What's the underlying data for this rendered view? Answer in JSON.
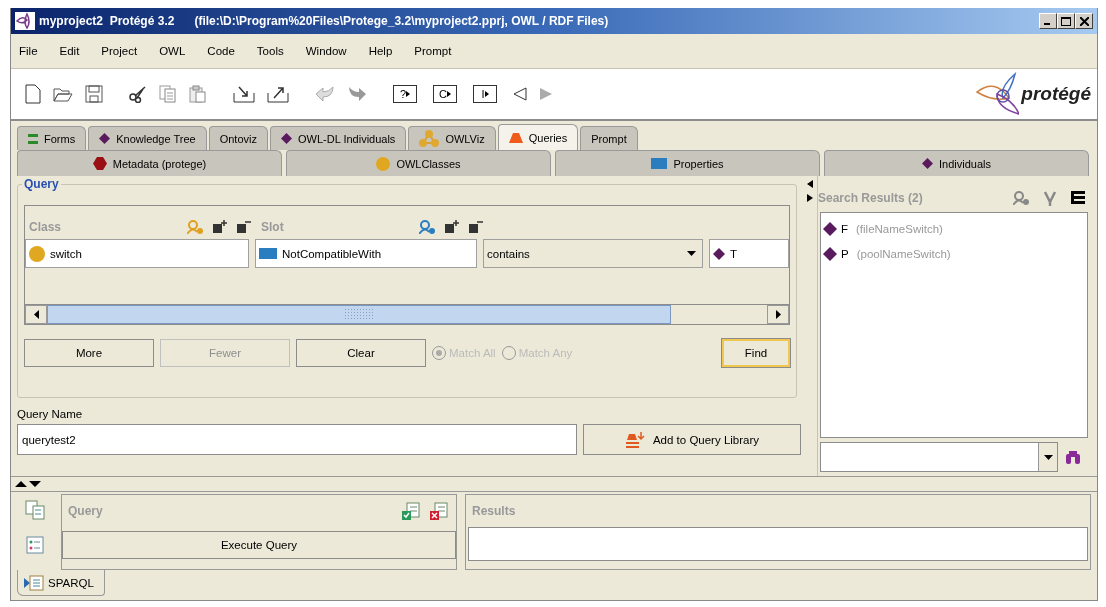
{
  "window": {
    "title": "myproject2  Protégé 3.2      (file:\\D:\\Program%20Files\\Protege_3.2\\myproject2.pprj, OWL / RDF Files)"
  },
  "menu": [
    "File",
    "Edit",
    "Project",
    "OWL",
    "Code",
    "Tools",
    "Window",
    "Help",
    "Prompt"
  ],
  "toolbar": {
    "letter_buttons": [
      "?",
      "C",
      "I"
    ]
  },
  "logo": {
    "text": "protégé"
  },
  "tabs_row1": [
    {
      "label": "Forms",
      "kind": "forms",
      "selected": false
    },
    {
      "label": "Knowledge Tree",
      "kind": "individual",
      "selected": false
    },
    {
      "label": "Ontoviz",
      "kind": "plain",
      "selected": false
    },
    {
      "label": "OWL-DL Individuals",
      "kind": "individual",
      "selected": false
    },
    {
      "label": "OWLViz",
      "kind": "graph",
      "selected": false
    },
    {
      "label": "Queries",
      "kind": "query",
      "selected": true
    },
    {
      "label": "Prompt",
      "kind": "plain",
      "selected": false
    }
  ],
  "tabs_row2": [
    {
      "label": "Metadata (protege)",
      "kind": "metadata",
      "selected": false
    },
    {
      "label": "OWLClasses",
      "kind": "class",
      "selected": false
    },
    {
      "label": "Properties",
      "kind": "property",
      "selected": false
    },
    {
      "label": "Individuals",
      "kind": "individual",
      "selected": false
    }
  ],
  "query": {
    "title": "Query",
    "class_header": "Class",
    "slot_header": "Slot",
    "class_value": "switch",
    "slot_value": "NotCompatibleWith",
    "operator": "contains",
    "value": "T",
    "buttons": [
      {
        "label": "More",
        "disabled": false,
        "default": false
      },
      {
        "label": "Fewer",
        "disabled": true,
        "default": false
      },
      {
        "label": "Clear",
        "disabled": false,
        "default": false
      }
    ],
    "match": [
      {
        "label": "Match All",
        "selected": true,
        "disabled": true
      },
      {
        "label": "Match Any",
        "selected": false,
        "disabled": true
      }
    ],
    "find": {
      "label": "Find",
      "disabled": false,
      "default": true
    }
  },
  "query_name": {
    "label": "Query Name",
    "value": "querytest2",
    "add_button": "Add to Query Library"
  },
  "search_results": {
    "title": "Search Results (2)",
    "items": [
      {
        "name": "F",
        "detail": "(fileNameSwitch)"
      },
      {
        "name": "P",
        "detail": "(poolNameSwitch)"
      }
    ]
  },
  "sparql": {
    "query_title": "Query",
    "execute_button": "Execute Query",
    "results_title": "Results",
    "tab": "SPARQL"
  }
}
